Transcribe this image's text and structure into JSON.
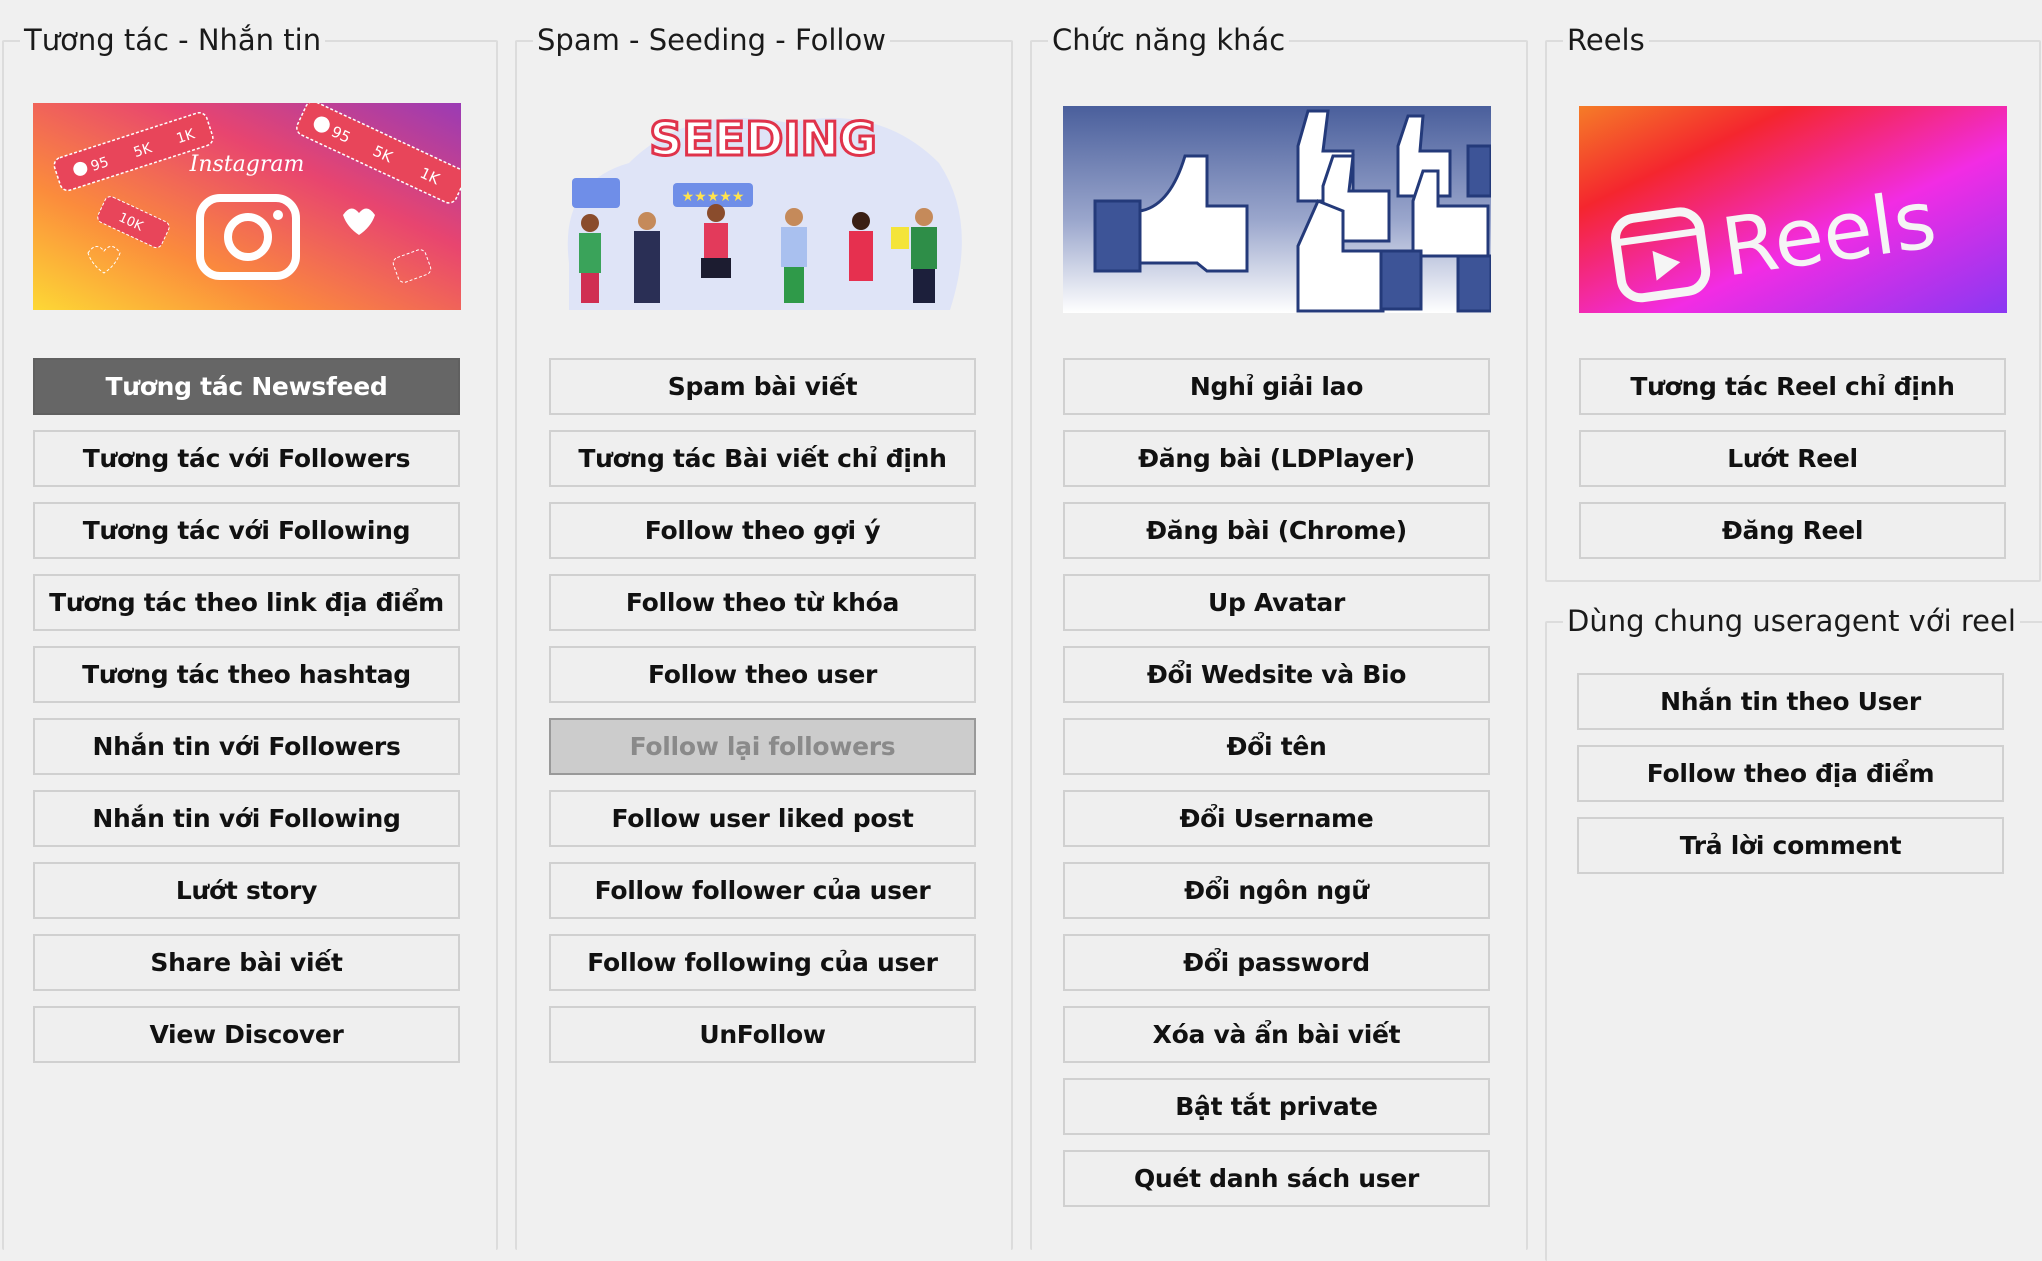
{
  "groups": {
    "interact": {
      "title": "Tương tác - Nhắn tin",
      "banner": {
        "alt": "Instagram banner",
        "brand_text": "Instagram",
        "badges": [
          "95",
          "5K",
          "1K",
          "10K"
        ]
      },
      "buttons": [
        {
          "label": "Tương tác Newsfeed",
          "state": "active"
        },
        {
          "label": "Tương tác với Followers",
          "state": "normal"
        },
        {
          "label": "Tương tác với Following",
          "state": "normal"
        },
        {
          "label": "Tương tác theo link địa điểm",
          "state": "normal"
        },
        {
          "label": "Tương tác theo hashtag",
          "state": "normal"
        },
        {
          "label": "Nhắn tin với Followers",
          "state": "normal"
        },
        {
          "label": "Nhắn tin với Following",
          "state": "normal"
        },
        {
          "label": "Lướt story",
          "state": "normal"
        },
        {
          "label": "Share bài viết",
          "state": "normal"
        },
        {
          "label": "View Discover",
          "state": "normal"
        }
      ]
    },
    "seeding": {
      "title": "Spam - Seeding - Follow",
      "banner": {
        "alt": "Seeding illustration",
        "brand_text": "SEEDING"
      },
      "buttons": [
        {
          "label": "Spam bài viết",
          "state": "normal"
        },
        {
          "label": "Tương tác Bài viết chỉ định",
          "state": "normal"
        },
        {
          "label": "Follow theo gợi ý",
          "state": "normal"
        },
        {
          "label": "Follow theo từ khóa",
          "state": "normal"
        },
        {
          "label": "Follow theo user",
          "state": "normal"
        },
        {
          "label": "Follow lại followers",
          "state": "disabled"
        },
        {
          "label": "Follow user liked post",
          "state": "normal"
        },
        {
          "label": "Follow follower của user",
          "state": "normal"
        },
        {
          "label": "Follow following của user",
          "state": "normal"
        },
        {
          "label": "UnFollow",
          "state": "normal"
        }
      ]
    },
    "other": {
      "title": "Chức năng khác",
      "banner": {
        "alt": "Facebook like thumbs"
      },
      "buttons": [
        {
          "label": "Nghỉ giải lao",
          "state": "normal"
        },
        {
          "label": "Đăng bài (LDPlayer)",
          "state": "normal"
        },
        {
          "label": "Đăng bài (Chrome)",
          "state": "normal"
        },
        {
          "label": "Up Avatar",
          "state": "normal"
        },
        {
          "label": "Đổi Wedsite và Bio",
          "state": "normal"
        },
        {
          "label": "Đổi tên",
          "state": "normal"
        },
        {
          "label": "Đổi Username",
          "state": "normal"
        },
        {
          "label": "Đổi ngôn ngữ",
          "state": "normal"
        },
        {
          "label": "Đổi password",
          "state": "normal"
        },
        {
          "label": "Xóa và ẩn bài viết",
          "state": "normal"
        },
        {
          "label": "Bật tắt private",
          "state": "normal"
        },
        {
          "label": "Quét danh sách user",
          "state": "normal"
        }
      ]
    },
    "reels": {
      "title": "Reels",
      "banner": {
        "alt": "Reels banner",
        "brand_text": "Reels"
      },
      "buttons": [
        {
          "label": "Tương tác Reel chỉ định",
          "state": "normal"
        },
        {
          "label": "Lướt Reel",
          "state": "normal"
        },
        {
          "label": "Đăng Reel",
          "state": "normal"
        }
      ]
    },
    "shared_ua": {
      "title": "Dùng chung useragent với reel",
      "buttons": [
        {
          "label": "Nhắn tin theo User",
          "state": "normal"
        },
        {
          "label": "Follow theo địa điểm",
          "state": "normal"
        },
        {
          "label": "Trả lời comment",
          "state": "normal"
        }
      ]
    }
  },
  "colors": {
    "background": "#f0f0f0",
    "button_active_bg": "#666666",
    "button_disabled_bg": "#cccccc",
    "instagram_gradient": [
      "#fdd835",
      "#fb8c3c",
      "#e8456f",
      "#9a3bb5"
    ],
    "reels_gradient": [
      "#f57c28",
      "#f4262e",
      "#f22ce4",
      "#8a38f2"
    ],
    "facebook_blue": "#4a5f9c"
  }
}
